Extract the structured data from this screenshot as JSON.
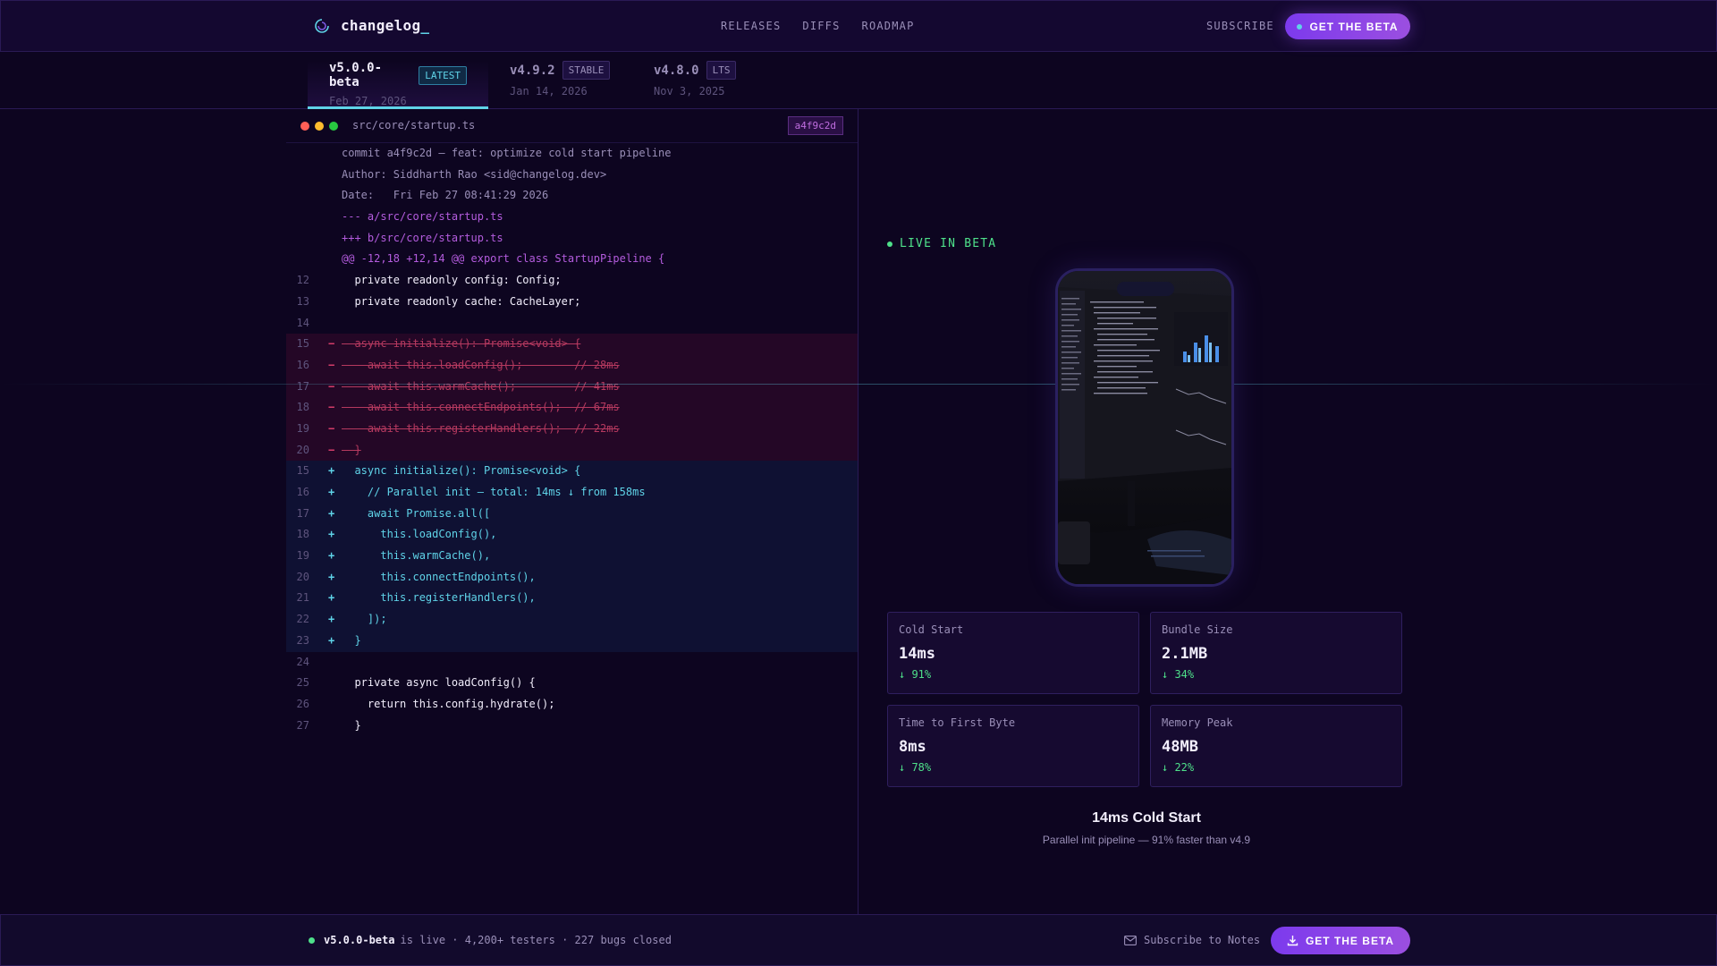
{
  "brand": {
    "name": "changelog",
    "cursor": "_"
  },
  "nav": {
    "links": [
      "RELEASES",
      "DIFFS",
      "ROADMAP"
    ],
    "subscribe": "SUBSCRIBE",
    "cta": "GET THE BETA"
  },
  "versions": [
    {
      "version": "v5.0.0-beta",
      "badge": "LATEST",
      "date": "Feb 27, 2026",
      "active": true
    },
    {
      "version": "v4.9.2",
      "badge": "STABLE",
      "date": "Jan 14, 2026",
      "active": false
    },
    {
      "version": "v4.8.0",
      "badge": "LTS",
      "date": "Nov 3, 2025",
      "active": false
    }
  ],
  "code": {
    "file": "src/core/startup.ts",
    "hash": "a4f9c2d",
    "lines": [
      {
        "kind": "meta",
        "ln": "",
        "sign": "",
        "text": "commit a4f9c2d — feat: optimize cold start pipeline"
      },
      {
        "kind": "meta",
        "ln": "",
        "sign": "",
        "text": "Author: Siddharth Rao <sid@changelog.dev>"
      },
      {
        "kind": "meta",
        "ln": "",
        "sign": "",
        "text": "Date:   Fri Feb 27 08:41:29 2026"
      },
      {
        "kind": "hdr",
        "ln": "",
        "sign": "",
        "text": "--- a/src/core/startup.ts"
      },
      {
        "kind": "hdr",
        "ln": "",
        "sign": "",
        "text": "+++ b/src/core/startup.ts"
      },
      {
        "kind": "hdr",
        "ln": "",
        "sign": "",
        "text": "@@ -12,18 +12,14 @@ export class StartupPipeline {"
      },
      {
        "kind": "ctx",
        "ln": "12",
        "sign": "",
        "text": "  private readonly config: Config;"
      },
      {
        "kind": "ctx",
        "ln": "13",
        "sign": "",
        "text": "  private readonly cache: CacheLayer;"
      },
      {
        "kind": "ctx",
        "ln": "14",
        "sign": "",
        "text": ""
      },
      {
        "kind": "del",
        "ln": "15",
        "sign": "−",
        "text": "  async initialize(): Promise<void> {"
      },
      {
        "kind": "del",
        "ln": "16",
        "sign": "−",
        "text": "    await this.loadConfig();        // 28ms"
      },
      {
        "kind": "del",
        "ln": "17",
        "sign": "−",
        "text": "    await this.warmCache();         // 41ms"
      },
      {
        "kind": "del",
        "ln": "18",
        "sign": "−",
        "text": "    await this.connectEndpoints();  // 67ms"
      },
      {
        "kind": "del",
        "ln": "19",
        "sign": "−",
        "text": "    await this.registerHandlers();  // 22ms"
      },
      {
        "kind": "del",
        "ln": "20",
        "sign": "−",
        "text": "  }"
      },
      {
        "kind": "add",
        "ln": "15",
        "sign": "+",
        "text": "  async initialize(): Promise<void> {"
      },
      {
        "kind": "add",
        "ln": "16",
        "sign": "+",
        "text": "    // Parallel init — total: 14ms ↓ from 158ms"
      },
      {
        "kind": "add",
        "ln": "17",
        "sign": "+",
        "text": "    await Promise.all(["
      },
      {
        "kind": "add",
        "ln": "18",
        "sign": "+",
        "text": "      this.loadConfig(),"
      },
      {
        "kind": "add",
        "ln": "19",
        "sign": "+",
        "text": "      this.warmCache(),"
      },
      {
        "kind": "add",
        "ln": "20",
        "sign": "+",
        "text": "      this.connectEndpoints(),"
      },
      {
        "kind": "add",
        "ln": "21",
        "sign": "+",
        "text": "      this.registerHandlers(),"
      },
      {
        "kind": "add",
        "ln": "22",
        "sign": "+",
        "text": "    ]);"
      },
      {
        "kind": "add",
        "ln": "23",
        "sign": "+",
        "text": "  }"
      },
      {
        "kind": "ctx",
        "ln": "24",
        "sign": "",
        "text": ""
      },
      {
        "kind": "ctx",
        "ln": "25",
        "sign": "",
        "text": "  private async loadConfig() {"
      },
      {
        "kind": "ctx",
        "ln": "26",
        "sign": "",
        "text": "    return this.config.hydrate();"
      },
      {
        "kind": "ctx",
        "ln": "27",
        "sign": "",
        "text": "  }"
      }
    ]
  },
  "live": "LIVE IN BETA",
  "stats": [
    {
      "label": "Cold Start",
      "value": "14ms",
      "delta": "↓ 91%"
    },
    {
      "label": "Bundle Size",
      "value": "2.1MB",
      "delta": "↓ 34%"
    },
    {
      "label": "Time to First Byte",
      "value": "8ms",
      "delta": "↓ 78%"
    },
    {
      "label": "Memory Peak",
      "value": "48MB",
      "delta": "↓ 22%"
    }
  ],
  "caption": {
    "title": "14ms Cold Start",
    "subtitle": "Parallel init pipeline — 91% faster than v4.9"
  },
  "bottom": {
    "version": "v5.0.0-beta",
    "status": "is live · 4,200+ testers · 227 bugs closed",
    "subscribe": "Subscribe to Notes",
    "cta": "GET THE BETA"
  },
  "colors": {
    "accent": "#7c3aed",
    "cyan": "#5fd3e8",
    "green": "#4ee08a",
    "red": "#e0406e"
  }
}
